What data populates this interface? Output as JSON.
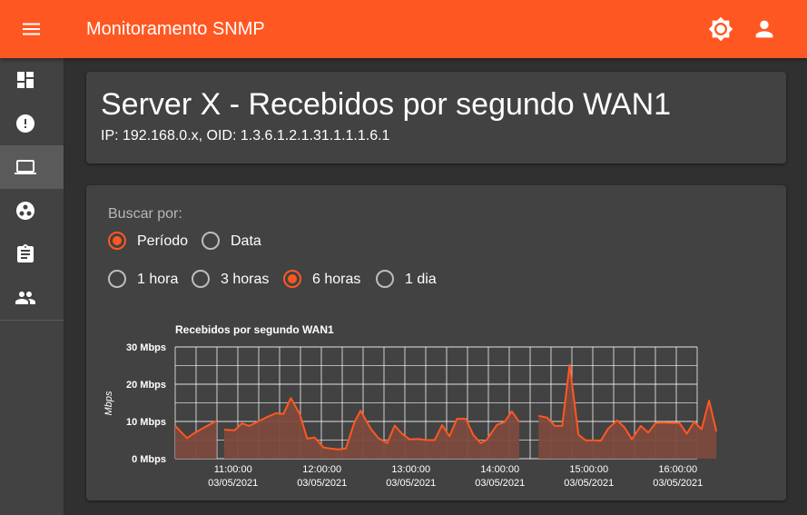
{
  "appbar": {
    "title": "Monitoramento SNMP"
  },
  "header": {
    "title": "Server X - Recebidos por segundo WAN1",
    "subtitle": "IP: 192.168.0.x, OID: 1.3.6.1.2.1.31.1.1.1.6.1"
  },
  "search": {
    "label": "Buscar por:",
    "mode_options": [
      {
        "label": "Período",
        "checked": true
      },
      {
        "label": "Data",
        "checked": false
      }
    ],
    "range_options": [
      {
        "label": "1 hora",
        "checked": false
      },
      {
        "label": "3 horas",
        "checked": false
      },
      {
        "label": "6 horas",
        "checked": true
      },
      {
        "label": "1 dia",
        "checked": false
      }
    ]
  },
  "sidebar": {
    "items": [
      {
        "icon": "dashboard-icon",
        "active": false
      },
      {
        "icon": "alert-icon",
        "active": false
      },
      {
        "icon": "laptop-icon",
        "active": true
      },
      {
        "icon": "hub-icon",
        "active": false
      },
      {
        "icon": "clipboard-icon",
        "active": false
      },
      {
        "icon": "people-icon",
        "active": false
      }
    ]
  },
  "colors": {
    "accent": "#ff5722",
    "area_fill": "#7c4a3d",
    "card": "#424242",
    "background": "#303030"
  },
  "chart_data": {
    "type": "area",
    "title": "Recebidos por segundo WAN1",
    "ylabel": "Mbps",
    "ylim": [
      0,
      30
    ],
    "yticks": [
      "0 Mbps",
      "10 Mbps",
      "20 Mbps",
      "30 Mbps"
    ],
    "x_time_range": [
      "10:21",
      "16:13"
    ],
    "xticks": [
      {
        "time": "11:00:00",
        "date": "03/05/2021"
      },
      {
        "time": "12:00:00",
        "date": "03/05/2021"
      },
      {
        "time": "13:00:00",
        "date": "03/05/2021"
      },
      {
        "time": "14:00:00",
        "date": "03/05/2021"
      },
      {
        "time": "15:00:00",
        "date": "03/05/2021"
      },
      {
        "time": "16:00:00",
        "date": "03/05/2021"
      }
    ],
    "grid": true,
    "series": [
      {
        "segments": [
          [
            [
              "10:21",
              8.8
            ],
            [
              "10:29",
              5.5
            ],
            [
              "10:34",
              6.9
            ],
            [
              "10:43",
              8.9
            ],
            [
              "10:49",
              10.2
            ]
          ],
          [
            [
              "10:54",
              7.8
            ],
            [
              "11:01",
              7.6
            ],
            [
              "11:06",
              9.5
            ],
            [
              "11:11",
              8.8
            ],
            [
              "11:17",
              10.0
            ],
            [
              "11:23",
              11.2
            ],
            [
              "11:29",
              12.2
            ],
            [
              "11:34",
              12.0
            ],
            [
              "11:39",
              16.3
            ],
            [
              "11:45",
              12.0
            ],
            [
              "11:50",
              5.4
            ],
            [
              "11:55",
              5.7
            ],
            [
              "12:01",
              3.0
            ],
            [
              "12:06",
              2.7
            ],
            [
              "12:11",
              2.5
            ],
            [
              "12:16",
              2.7
            ],
            [
              "12:22",
              9.9
            ],
            [
              "12:26",
              12.9
            ],
            [
              "12:33",
              8.0
            ],
            [
              "12:38",
              5.5
            ],
            [
              "12:44",
              4.2
            ],
            [
              "12:49",
              8.9
            ],
            [
              "12:54",
              6.7
            ],
            [
              "12:59",
              5.2
            ],
            [
              "13:05",
              5.3
            ],
            [
              "13:10",
              5.0
            ],
            [
              "13:16",
              5.0
            ],
            [
              "13:21",
              9.0
            ],
            [
              "13:26",
              6.0
            ],
            [
              "13:31",
              10.7
            ],
            [
              "13:37",
              10.7
            ],
            [
              "13:42",
              6.4
            ],
            [
              "13:47",
              4.2
            ],
            [
              "13:51",
              5.0
            ],
            [
              "13:58",
              9.1
            ],
            [
              "14:03",
              9.8
            ],
            [
              "14:08",
              12.7
            ],
            [
              "14:13",
              9.9
            ]
          ],
          [
            [
              "14:26",
              11.5
            ],
            [
              "14:32",
              11.0
            ],
            [
              "14:37",
              8.8
            ],
            [
              "14:42",
              8.8
            ],
            [
              "14:47",
              25.2
            ],
            [
              "14:53",
              6.4
            ],
            [
              "14:58",
              4.9
            ],
            [
              "15:03",
              4.9
            ],
            [
              "15:08",
              4.8
            ],
            [
              "15:13",
              8.1
            ],
            [
              "15:19",
              10.3
            ],
            [
              "15:24",
              8.4
            ],
            [
              "15:29",
              5.2
            ],
            [
              "15:35",
              8.8
            ],
            [
              "15:40",
              7.0
            ],
            [
              "15:45",
              9.6
            ],
            [
              "15:50",
              9.7
            ],
            [
              "15:55",
              9.6
            ],
            [
              "16:01",
              9.6
            ],
            [
              "16:06",
              6.7
            ],
            [
              "16:11",
              9.9
            ],
            [
              "16:16",
              7.9
            ],
            [
              "16:21",
              15.6
            ],
            [
              "16:26",
              7.3
            ]
          ]
        ]
      }
    ]
  }
}
